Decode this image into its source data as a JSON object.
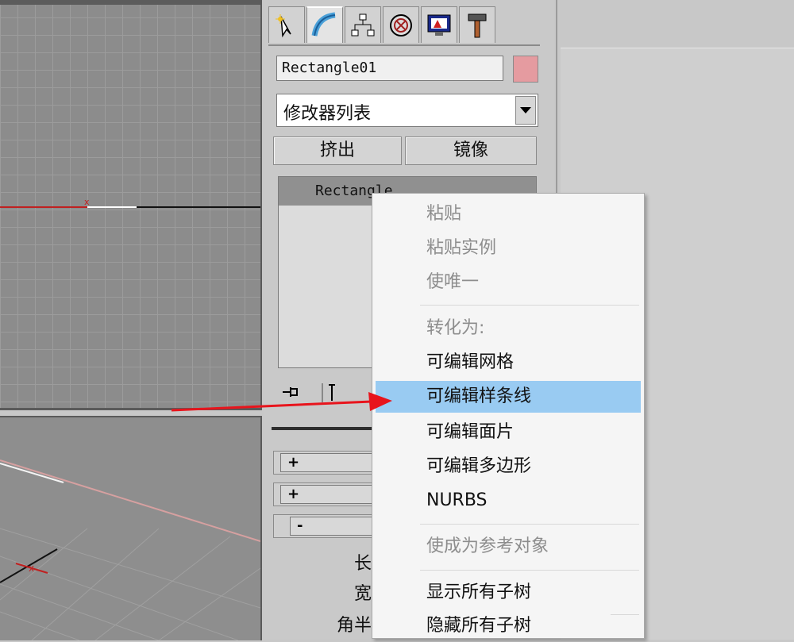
{
  "panel": {
    "object_name": "Rectangle01",
    "object_color": "#e59ba0",
    "modifier_list": "修改器列表",
    "buttons": [
      "挤出",
      "镜像"
    ],
    "stack_item": "Rectangle",
    "tabs": [
      "create-icon",
      "modify-icon",
      "hierarchy-icon",
      "motion-icon",
      "display-icon",
      "utilities-icon"
    ]
  },
  "rollouts": [
    {
      "toggle": "+"
    },
    {
      "toggle": "+"
    },
    {
      "toggle": "-"
    }
  ],
  "params": [
    "长",
    "宽",
    "角半"
  ],
  "context_menu": {
    "items": [
      {
        "label": "粘贴",
        "state": "disabled"
      },
      {
        "label": "粘贴实例",
        "state": "disabled"
      },
      {
        "label": "使唯一",
        "state": "disabled"
      },
      {
        "label": "转化为:",
        "state": "header"
      },
      {
        "label": "可编辑网格",
        "state": "normal"
      },
      {
        "label": "可编辑样条线",
        "state": "highlighted"
      },
      {
        "label": "可编辑面片",
        "state": "normal"
      },
      {
        "label": "可编辑多边形",
        "state": "normal"
      },
      {
        "label": "NURBS",
        "state": "normal"
      },
      {
        "label": "使成为参考对象",
        "state": "disabled"
      },
      {
        "label": "显示所有子树",
        "state": "normal"
      },
      {
        "label": "隐藏所有子树",
        "state": "normal"
      }
    ],
    "highlight_color": "#99cbf2"
  },
  "annotation": {
    "arrow_color": "#e8141c"
  }
}
